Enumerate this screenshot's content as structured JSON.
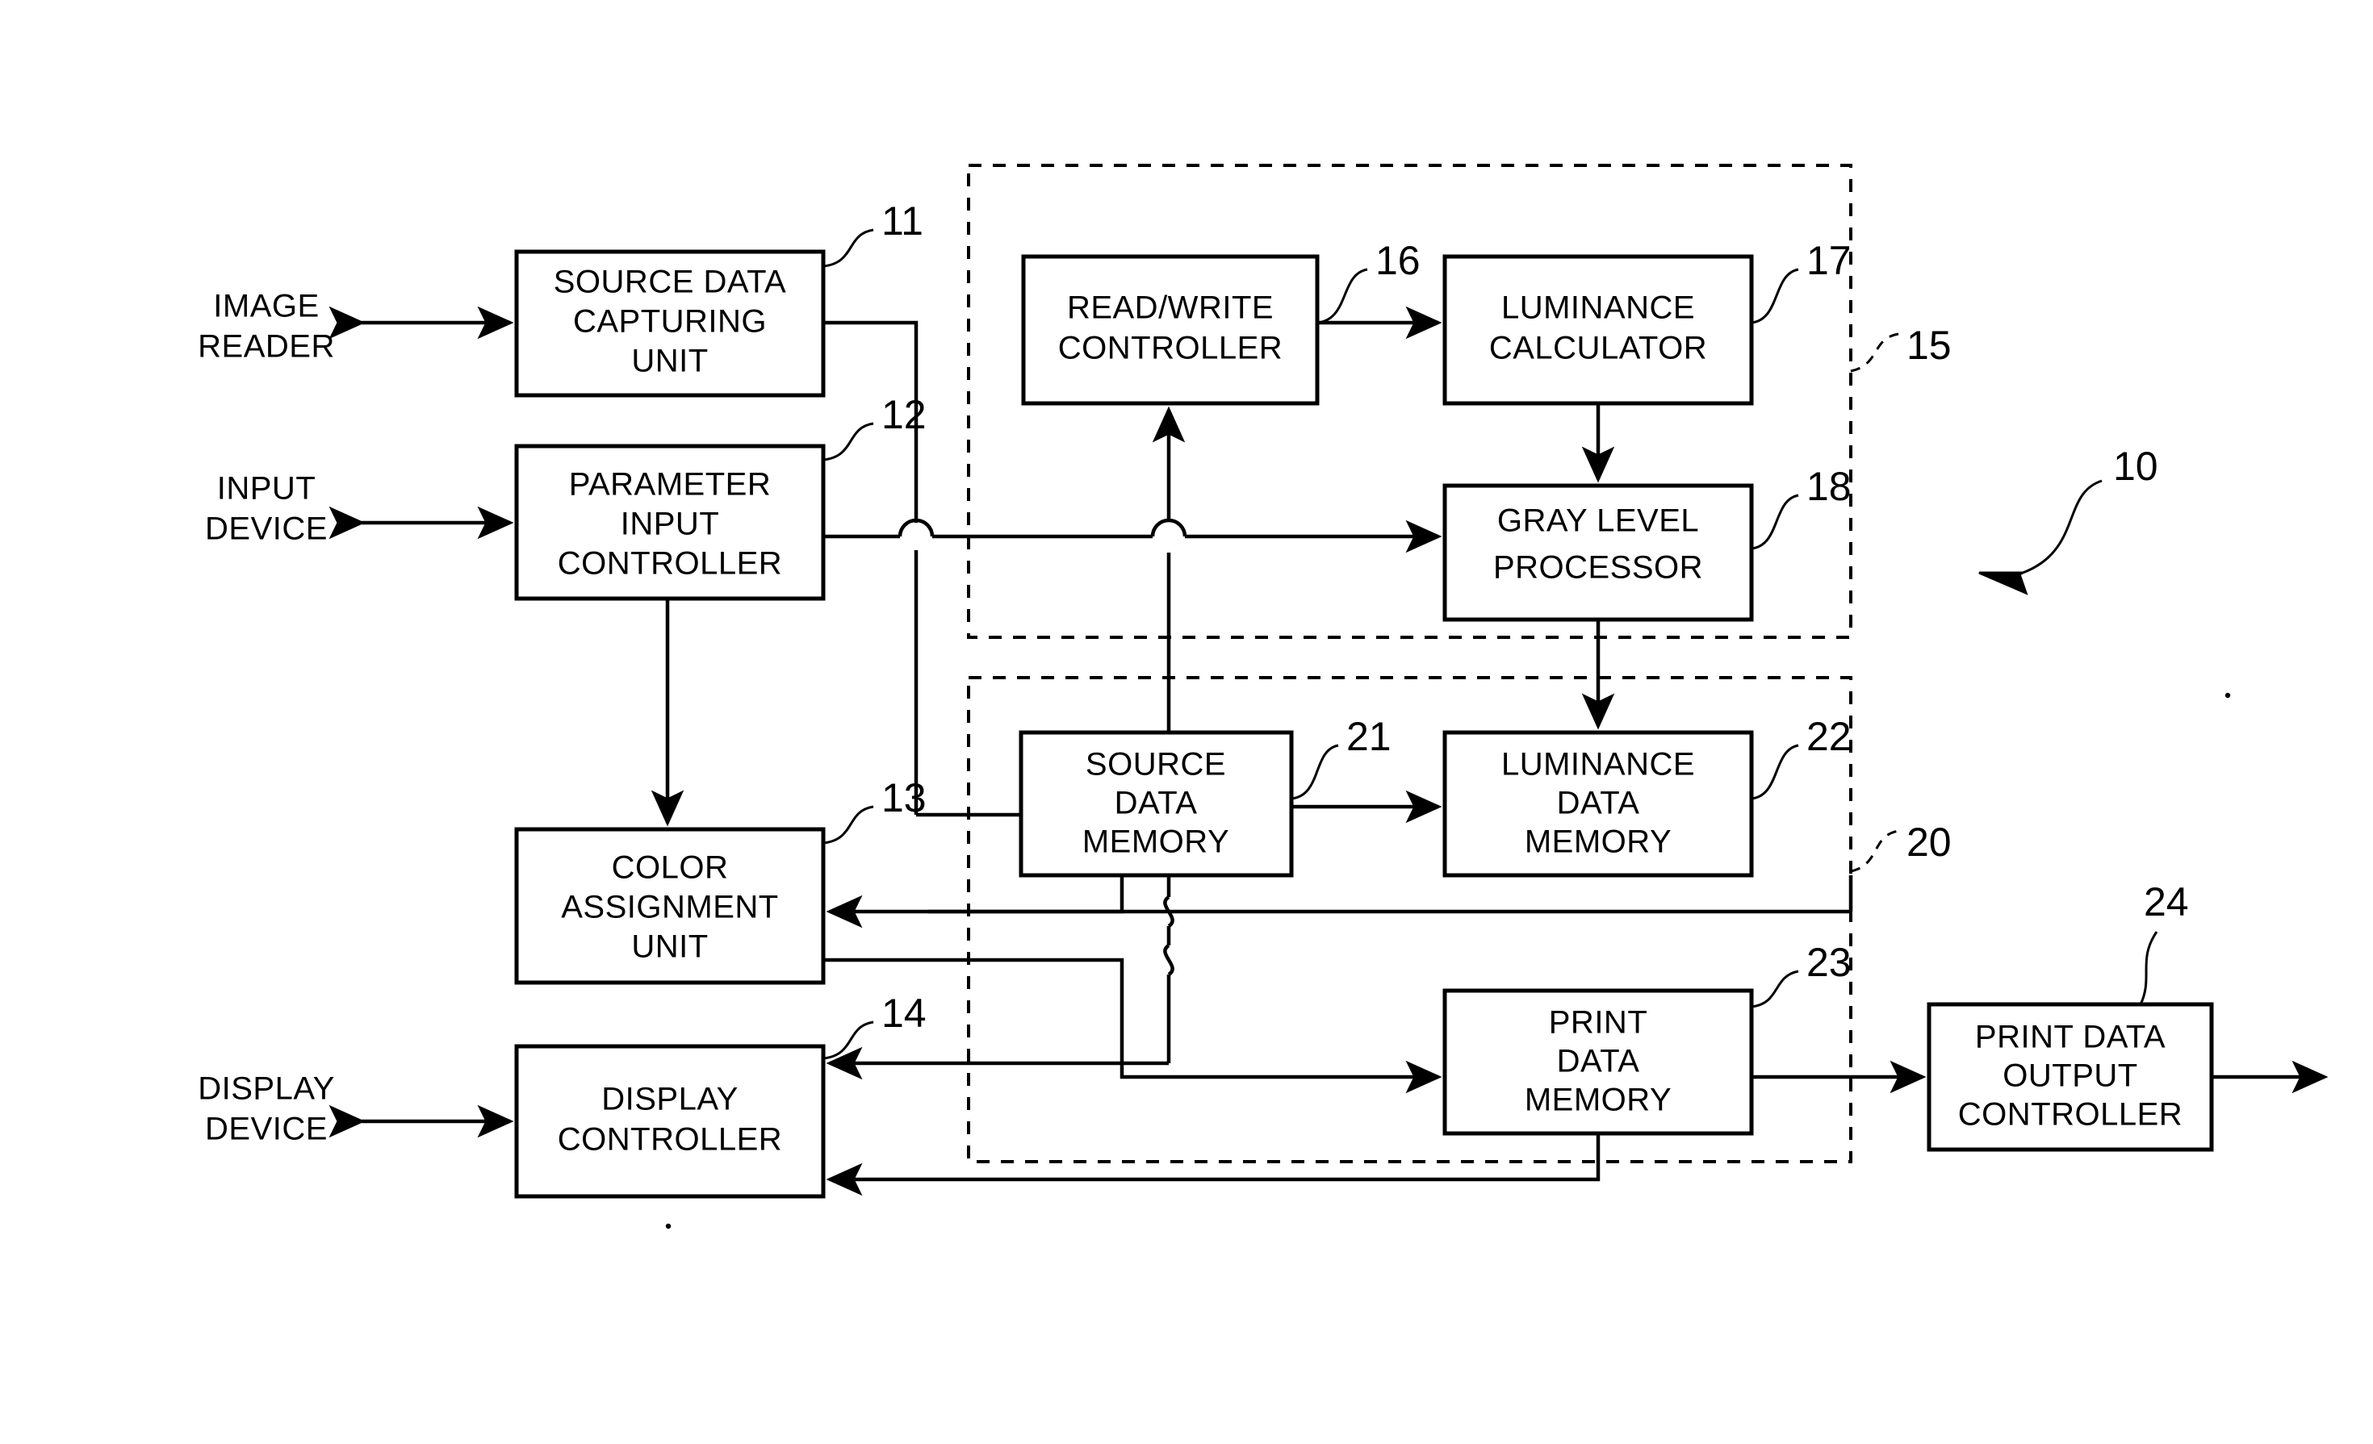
{
  "figure": {
    "type": "patent-block-diagram",
    "overall_ref": "10"
  },
  "external_labels": [
    {
      "id": "image-reader",
      "line1": "IMAGE",
      "line2": "READER"
    },
    {
      "id": "input-device",
      "line1": "INPUT",
      "line2": "DEVICE"
    },
    {
      "id": "display-device",
      "line1": "DISPLAY",
      "line2": "DEVICE"
    }
  ],
  "blocks": [
    {
      "ref": "11",
      "id": "source-data-capturing-unit",
      "lines": [
        "SOURCE DATA",
        "CAPTURING",
        "UNIT"
      ]
    },
    {
      "ref": "12",
      "id": "parameter-input-controller",
      "lines": [
        "PARAMETER",
        "INPUT",
        "CONTROLLER"
      ]
    },
    {
      "ref": "13",
      "id": "color-assignment-unit",
      "lines": [
        "COLOR",
        "ASSIGNMENT",
        "UNIT"
      ]
    },
    {
      "ref": "14",
      "id": "display-controller",
      "lines": [
        "DISPLAY",
        "CONTROLLER"
      ]
    },
    {
      "ref": "16",
      "id": "read-write-controller",
      "lines": [
        "READ/WRITE",
        "CONTROLLER"
      ]
    },
    {
      "ref": "17",
      "id": "luminance-calculator",
      "lines": [
        "LUMINANCE",
        "CALCULATOR"
      ]
    },
    {
      "ref": "18",
      "id": "gray-level-processor",
      "lines": [
        "GRAY LEVEL",
        "PROCESSOR"
      ]
    },
    {
      "ref": "21",
      "id": "source-data-memory",
      "lines": [
        "SOURCE",
        "DATA",
        "MEMORY"
      ]
    },
    {
      "ref": "22",
      "id": "luminance-data-memory",
      "lines": [
        "LUMINANCE",
        "DATA",
        "MEMORY"
      ]
    },
    {
      "ref": "23",
      "id": "print-data-memory",
      "lines": [
        "PRINT",
        "DATA",
        "MEMORY"
      ]
    },
    {
      "ref": "24",
      "id": "print-data-output-controller",
      "lines": [
        "PRINT DATA",
        "OUTPUT",
        "CONTROLLER"
      ]
    }
  ],
  "groups": [
    {
      "ref": "15",
      "id": "processing-unit-group"
    },
    {
      "ref": "20",
      "id": "memory-unit-group"
    }
  ],
  "colors": {
    "ink": "#000000",
    "paper": "#ffffff"
  }
}
